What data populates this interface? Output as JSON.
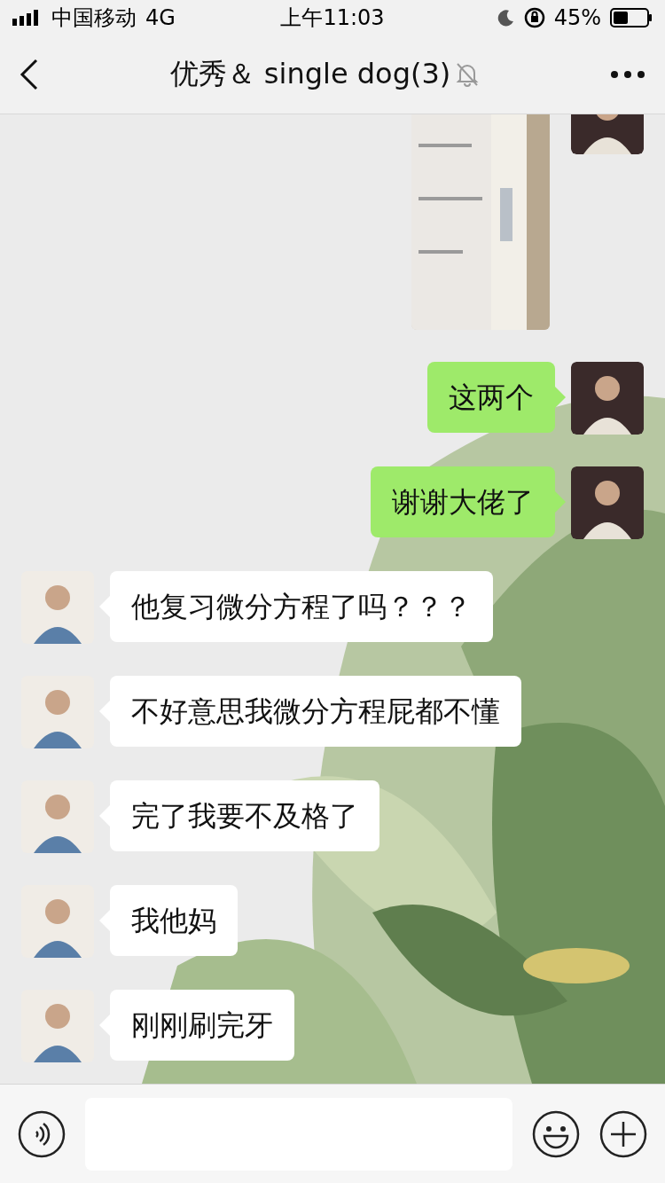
{
  "status_bar": {
    "carrier": "中国移动",
    "network": "4G",
    "time": "上午11:03",
    "battery": "45%"
  },
  "nav": {
    "title": "优秀＆ single dog(3)",
    "muted": true
  },
  "messages": [
    {
      "kind": "sent_image"
    },
    {
      "kind": "sent_text",
      "text": "这两个"
    },
    {
      "kind": "sent_text",
      "text": "谢谢大佬了"
    },
    {
      "kind": "received_text",
      "text": "他复习微分方程了吗？？？"
    },
    {
      "kind": "received_text",
      "text": "不好意思我微分方程屁都不懂"
    },
    {
      "kind": "received_text",
      "text": "完了我要不及格了"
    },
    {
      "kind": "received_text",
      "text": "我他妈"
    },
    {
      "kind": "received_text",
      "text": "刚刚刷完牙"
    }
  ]
}
